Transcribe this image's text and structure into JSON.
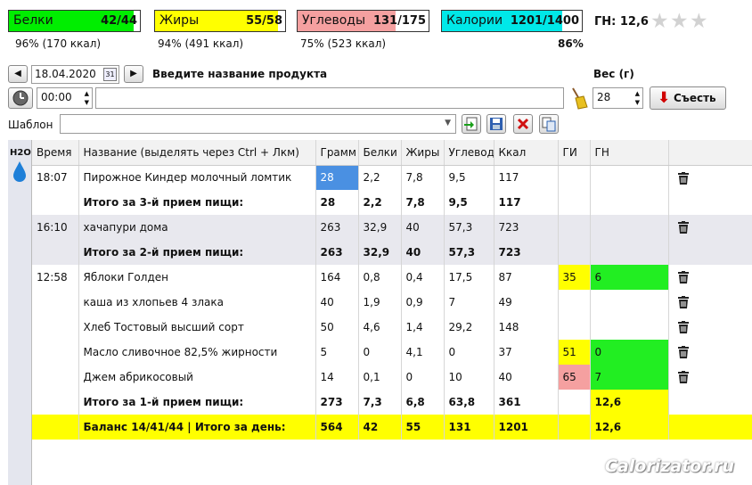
{
  "bars": [
    {
      "label": "Белки",
      "value": "42/44",
      "sub": "96% (170 ккал)",
      "color": "#00ee00",
      "fill": 0.955
    },
    {
      "label": "Жиры",
      "value": "55/58",
      "sub": "94% (491 ккал)",
      "color": "#ffff00",
      "fill": 0.948
    },
    {
      "label": "Углеводы",
      "value": "131/175",
      "sub": "75% (523 ккал)",
      "color": "#f5a0a0",
      "fill": 0.749
    },
    {
      "label": "Калории",
      "value": "1201/1400",
      "sub": "86%",
      "color": "#00e8e8",
      "fill": 0.858
    }
  ],
  "gn_summary": "ГН: 12,6",
  "date": "18.04.2020",
  "calendar_day": "31",
  "product_prompt": "Введите название продукта",
  "weight_label": "Вес (г)",
  "time": "00:00",
  "weight": "28",
  "eat_button": "Съесть",
  "template_label": "Шаблон",
  "h2o": "H2O",
  "columns": [
    "Время",
    "Название (выделять через Ctrl + Лкм)",
    "Грамм",
    "Белки",
    "Жиры",
    "Углеводы",
    "Ккал",
    "ГИ",
    "ГН"
  ],
  "rows": [
    {
      "time": "18:07",
      "name": "Пирожное Киндер молочный ломтик",
      "g": "28",
      "b": "2,2",
      "f": "7,8",
      "c": "9,5",
      "k": "117",
      "gi": "",
      "gn": "",
      "trash": true
    },
    {
      "time": "",
      "name": "Итого за 3-й прием пищи:",
      "g": "28",
      "b": "2,2",
      "f": "7,8",
      "c": "9,5",
      "k": "117",
      "gi": "",
      "gn": "",
      "tot": true
    },
    {
      "time": "16:10",
      "name": "хачапури дома",
      "g": "263",
      "b": "32,9",
      "f": "40",
      "c": "57,3",
      "k": "723",
      "gi": "",
      "gn": "",
      "trash": true,
      "grey": true
    },
    {
      "time": "",
      "name": "Итого за 2-й прием пищи:",
      "g": "263",
      "b": "32,9",
      "f": "40",
      "c": "57,3",
      "k": "723",
      "gi": "",
      "gn": "",
      "tot": true,
      "grey": true
    },
    {
      "time": "12:58",
      "name": "Яблоки Голден",
      "g": "164",
      "b": "0,8",
      "f": "0,4",
      "c": "17,5",
      "k": "87",
      "gi": "35",
      "gn": "6",
      "trash": true,
      "gic": "y",
      "gnc": "gr"
    },
    {
      "time": "",
      "name": "каша из хлопьев 4 злака",
      "g": "40",
      "b": "1,9",
      "f": "0,9",
      "c": "7",
      "k": "49",
      "gi": "",
      "gn": "",
      "trash": true
    },
    {
      "time": "",
      "name": "Хлеб Тостовый высший сорт",
      "g": "50",
      "b": "4,6",
      "f": "1,4",
      "c": "29,2",
      "k": "148",
      "gi": "",
      "gn": "",
      "trash": true
    },
    {
      "time": "",
      "name": "Масло сливочное 82,5% жирности",
      "g": "5",
      "b": "0",
      "f": "4,1",
      "c": "0",
      "k": "37",
      "gi": "51",
      "gn": "0",
      "trash": true,
      "gic": "y",
      "gnc": "gr"
    },
    {
      "time": "",
      "name": "Джем абрикосовый",
      "g": "14",
      "b": "0,1",
      "f": "0",
      "c": "10",
      "k": "40",
      "gi": "65",
      "gn": "7",
      "trash": true,
      "gic": "p",
      "gnc": "gr"
    },
    {
      "time": "",
      "name": "Итого за 1-й прием пищи:",
      "g": "273",
      "b": "7,3",
      "f": "6,8",
      "c": "63,8",
      "k": "361",
      "gi": "",
      "gn": "12,6",
      "tot": true,
      "gnc": "y"
    },
    {
      "time": "",
      "name": "Баланс 14/41/44  |  Итого за день:",
      "g": "564",
      "b": "42",
      "f": "55",
      "c": "131",
      "k": "1201",
      "gi": "",
      "gn": "12,6",
      "bal": true
    }
  ],
  "watermark": "Calorizator.ru"
}
